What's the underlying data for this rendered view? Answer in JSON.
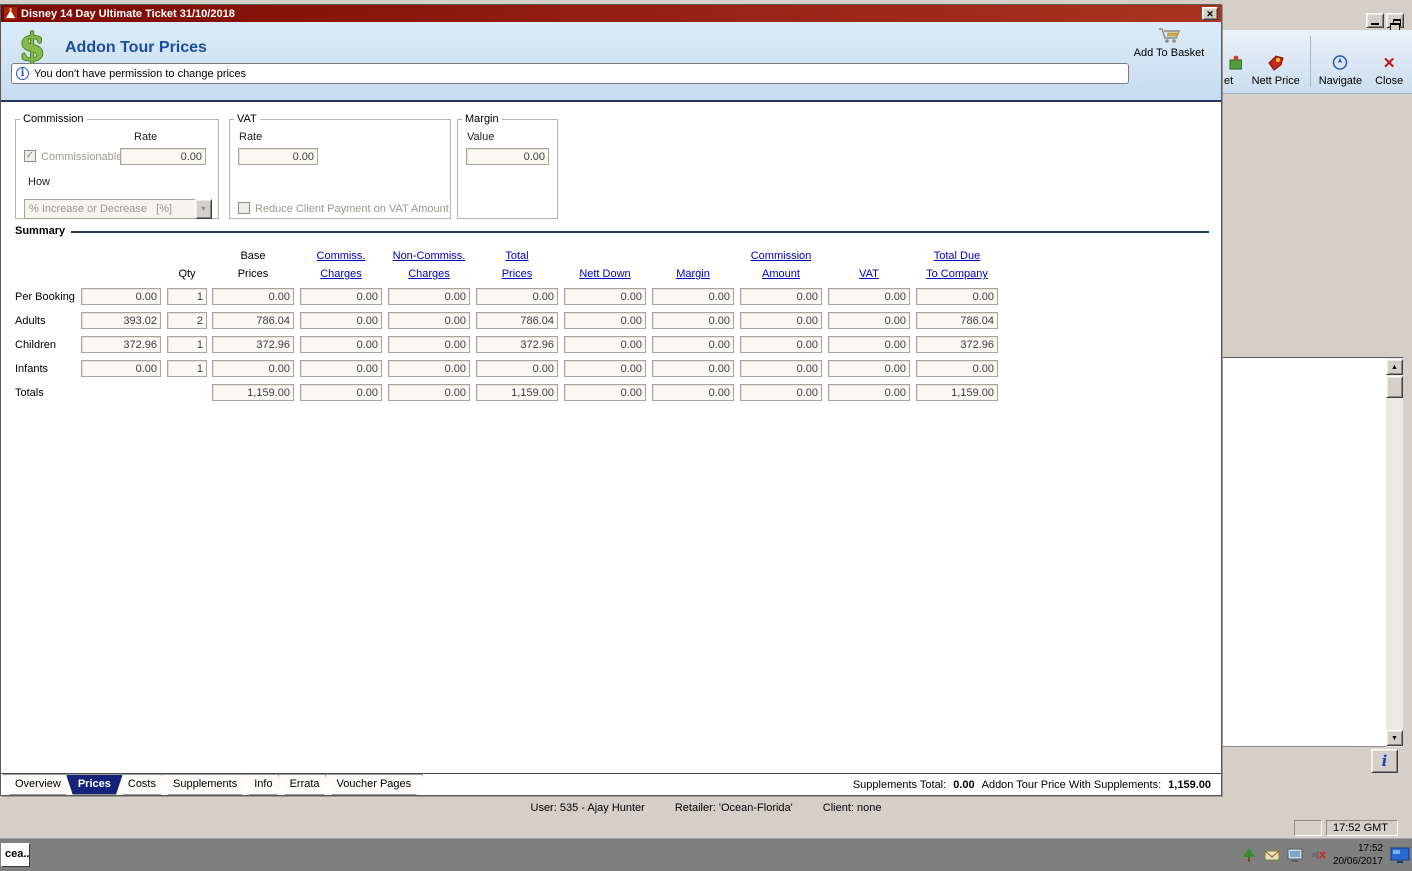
{
  "window": {
    "title": "Disney 14 Day Ultimate Ticket 31/10/2018"
  },
  "header": {
    "title": "Addon Tour Prices",
    "add_to_basket": "Add To Basket",
    "info_message": "You don't have permission to change prices"
  },
  "commission": {
    "legend": "Commission",
    "rate_label": "Rate",
    "commissionable_label": "Commissionable",
    "rate_value": "0.00",
    "how_label": "How",
    "how_value": "% Increase or Decrease   [%]"
  },
  "vat": {
    "legend": "VAT",
    "rate_label": "Rate",
    "rate_value": "0.00",
    "reduce_label": "Reduce Client Payment on VAT Amount"
  },
  "margin_box": {
    "legend": "Margin",
    "value_label": "Value",
    "value": "0.00"
  },
  "summary": {
    "title": "Summary",
    "h": {
      "qty": "Qty",
      "base1": "Base",
      "base2": "Prices",
      "com1": "Commiss.",
      "com2": "Charges",
      "ncom1": "Non-Commiss.",
      "ncom2": "Charges",
      "tot1": "Total",
      "tot2": "Prices",
      "nett": "Nett Down",
      "margin": "Margin",
      "cam1": "Commission",
      "cam2": "Amount",
      "vat": "VAT",
      "due1": "Total Due",
      "due2": "To Company"
    },
    "rows": [
      {
        "label": "Per Booking",
        "values": [
          "0.00",
          "1",
          "0.00",
          "0.00",
          "0.00",
          "0.00",
          "0.00",
          "0.00",
          "0.00",
          "0.00",
          "0.00"
        ]
      },
      {
        "label": "Adults",
        "values": [
          "393.02",
          "2",
          "786.04",
          "0.00",
          "0.00",
          "786.04",
          "0.00",
          "0.00",
          "0.00",
          "0.00",
          "786.04"
        ]
      },
      {
        "label": "Children",
        "values": [
          "372.96",
          "1",
          "372.96",
          "0.00",
          "0.00",
          "372.96",
          "0.00",
          "0.00",
          "0.00",
          "0.00",
          "372.96"
        ]
      },
      {
        "label": "Infants",
        "values": [
          "0.00",
          "1",
          "0.00",
          "0.00",
          "0.00",
          "0.00",
          "0.00",
          "0.00",
          "0.00",
          "0.00",
          "0.00"
        ]
      },
      {
        "label": "Totals",
        "values": [
          "",
          "",
          "1,159.00",
          "0.00",
          "0.00",
          "1,159.00",
          "0.00",
          "0.00",
          "0.00",
          "0.00",
          "1,159.00"
        ]
      }
    ]
  },
  "tabs": {
    "items": [
      "Overview",
      "Prices",
      "Costs",
      "Supplements",
      "Info",
      "Errata",
      "Voucher Pages"
    ],
    "selected": "Prices"
  },
  "footer": {
    "supplements_total_label": "Supplements Total:",
    "supplements_total_value": "0.00",
    "with_supplements_label": "Addon Tour Price With Supplements:",
    "with_supplements_value": "1,159.00"
  },
  "status": {
    "user": "User:  535 - Ajay Hunter",
    "retailer": "Retailer:  'Ocean-Florida'",
    "client": "Client:  none",
    "time_gmt": "17:52 GMT"
  },
  "bg_app": {
    "partial_button_label": "et",
    "nett_price_label": "Nett Price",
    "navigate_label": "Navigate",
    "close_label": "Close"
  },
  "taskbar": {
    "task_button": "cea...",
    "time": "17:52",
    "date": "20/06/2017"
  },
  "icons": {
    "window_close": "✕",
    "toolbar_close": "✕",
    "dropdown_arrow": "▼",
    "checkbox_check": "✓",
    "info_i": "i",
    "info_button": "i",
    "dollar": "$",
    "scroll_up": "▲",
    "scroll_down": "▼"
  }
}
